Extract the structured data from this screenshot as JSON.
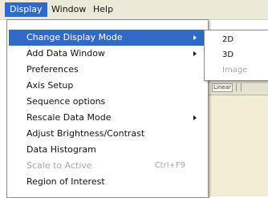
{
  "menubar": {
    "items": [
      {
        "label": "Display",
        "active": true
      },
      {
        "label": "Window"
      },
      {
        "label": "Help"
      }
    ]
  },
  "display_menu": {
    "items": [
      {
        "label": "Change Display Mode",
        "submenu": true,
        "highlighted": true
      },
      {
        "label": "Add Data Window",
        "submenu": true
      },
      {
        "label": "Preferences"
      },
      {
        "label": "Axis Setup"
      },
      {
        "label": "Sequence options"
      },
      {
        "label": "Rescale Data Mode",
        "submenu": true
      },
      {
        "label": "Adjust Brightness/Contrast"
      },
      {
        "label": "Data Histogram"
      },
      {
        "label": "Scale to Active",
        "shortcut": "Ctrl+F9",
        "disabled": true
      },
      {
        "label": "Region of Interest"
      }
    ]
  },
  "display_mode_submenu": {
    "items": [
      {
        "label": "2D"
      },
      {
        "label": "3D"
      },
      {
        "label": "Image",
        "disabled": true
      }
    ]
  },
  "background_window": {
    "toolbar_control_label": "Linear"
  },
  "colors": {
    "menubar_bg": "#ece9d8",
    "highlight": "#3169c6",
    "disabled_text": "#a8a8a8",
    "background_window": "#f2edd5"
  }
}
